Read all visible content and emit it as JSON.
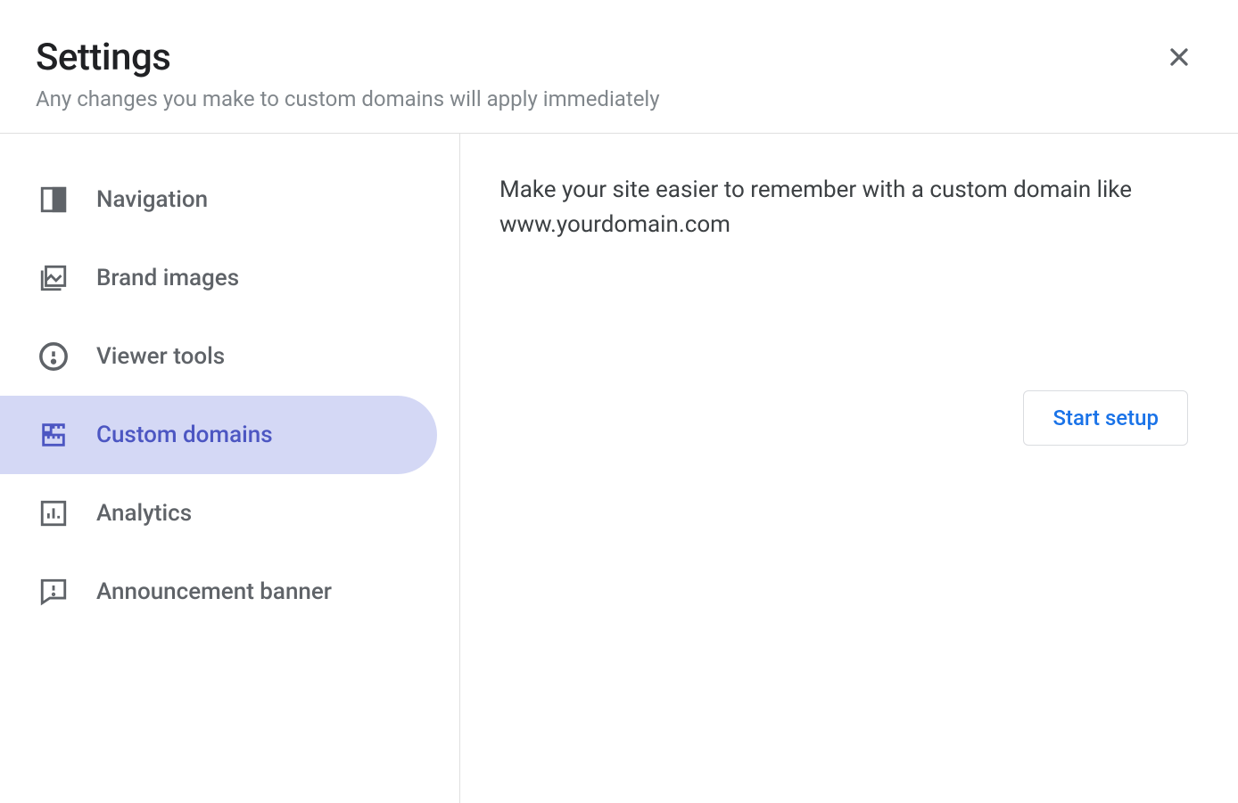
{
  "header": {
    "title": "Settings",
    "subtitle": "Any changes you make to custom domains will apply immediately"
  },
  "sidebar": {
    "items": [
      {
        "label": "Navigation",
        "icon": "navigation-icon",
        "active": false
      },
      {
        "label": "Brand images",
        "icon": "brand-images-icon",
        "active": false
      },
      {
        "label": "Viewer tools",
        "icon": "viewer-tools-icon",
        "active": false
      },
      {
        "label": "Custom domains",
        "icon": "custom-domains-icon",
        "active": true
      },
      {
        "label": "Analytics",
        "icon": "analytics-icon",
        "active": false
      },
      {
        "label": "Announcement banner",
        "icon": "announcement-banner-icon",
        "active": false
      }
    ]
  },
  "content": {
    "text": "Make your site easier to remember with a custom domain like www.yourdomain.com",
    "button_label": "Start setup"
  },
  "colors": {
    "accent": "#4c56c2",
    "button_text": "#1a73e8",
    "active_bg": "#d4d8f5",
    "text_primary": "#202124",
    "text_secondary": "#5f6368",
    "annotation_arrow": "#e64029"
  }
}
